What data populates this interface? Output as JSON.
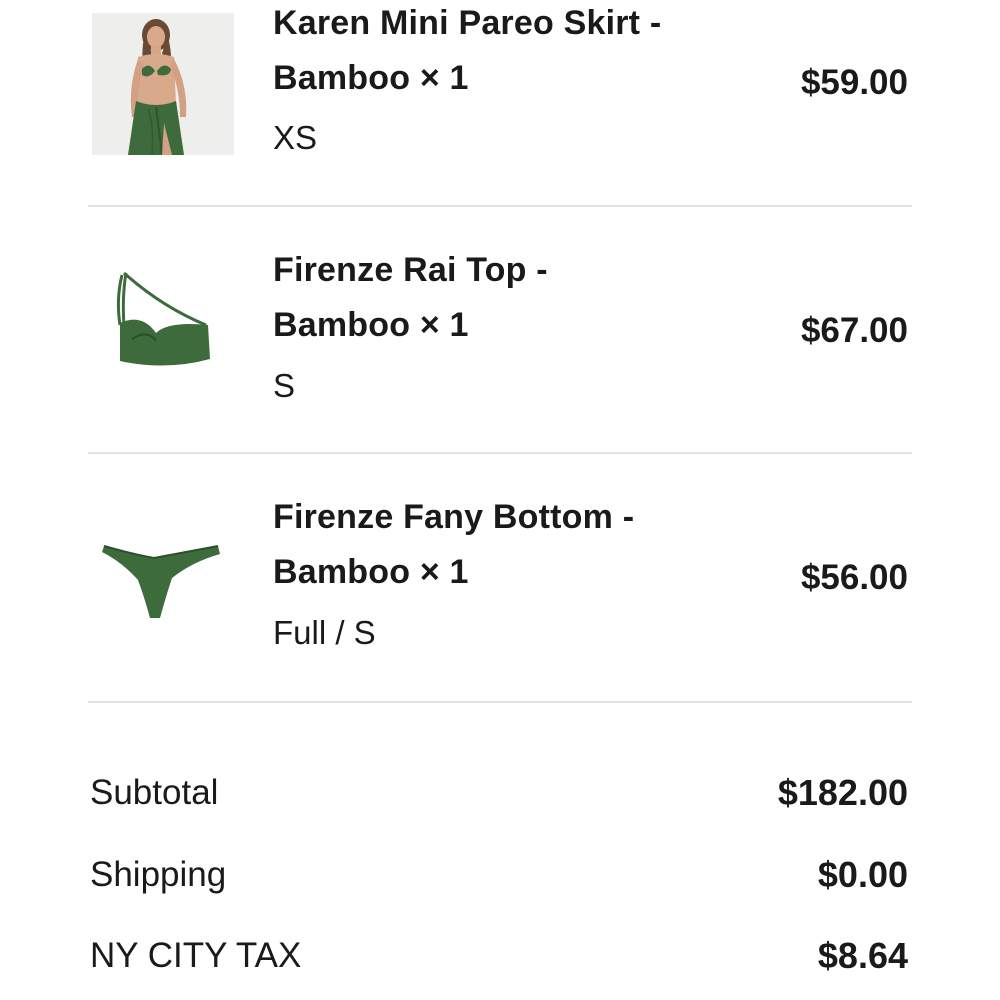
{
  "items": [
    {
      "name_line1": "Karen Mini Pareo Skirt -",
      "name_line2": "Bamboo × 1",
      "variant": "XS",
      "price": "$59.00",
      "thumbnail_icon": "model-wearing-skirt-photo"
    },
    {
      "name_line1": "Firenze Rai Top -",
      "name_line2": "Bamboo × 1",
      "variant": "S",
      "price": "$67.00",
      "thumbnail_icon": "one-shoulder-top-photo"
    },
    {
      "name_line1": "Firenze Fany Bottom -",
      "name_line2": "Bamboo × 1",
      "variant": "Full / S",
      "price": "$56.00",
      "thumbnail_icon": "bikini-bottom-photo"
    }
  ],
  "summary": {
    "subtotal_label": "Subtotal",
    "subtotal_value": "$182.00",
    "shipping_label": "Shipping",
    "shipping_value": "$0.00",
    "tax_label": "NY CITY TAX",
    "tax_value": "$8.64"
  },
  "colors": {
    "product_green": "#3e6b3c",
    "divider": "#e2e2e2",
    "text": "#1a1a1a"
  }
}
